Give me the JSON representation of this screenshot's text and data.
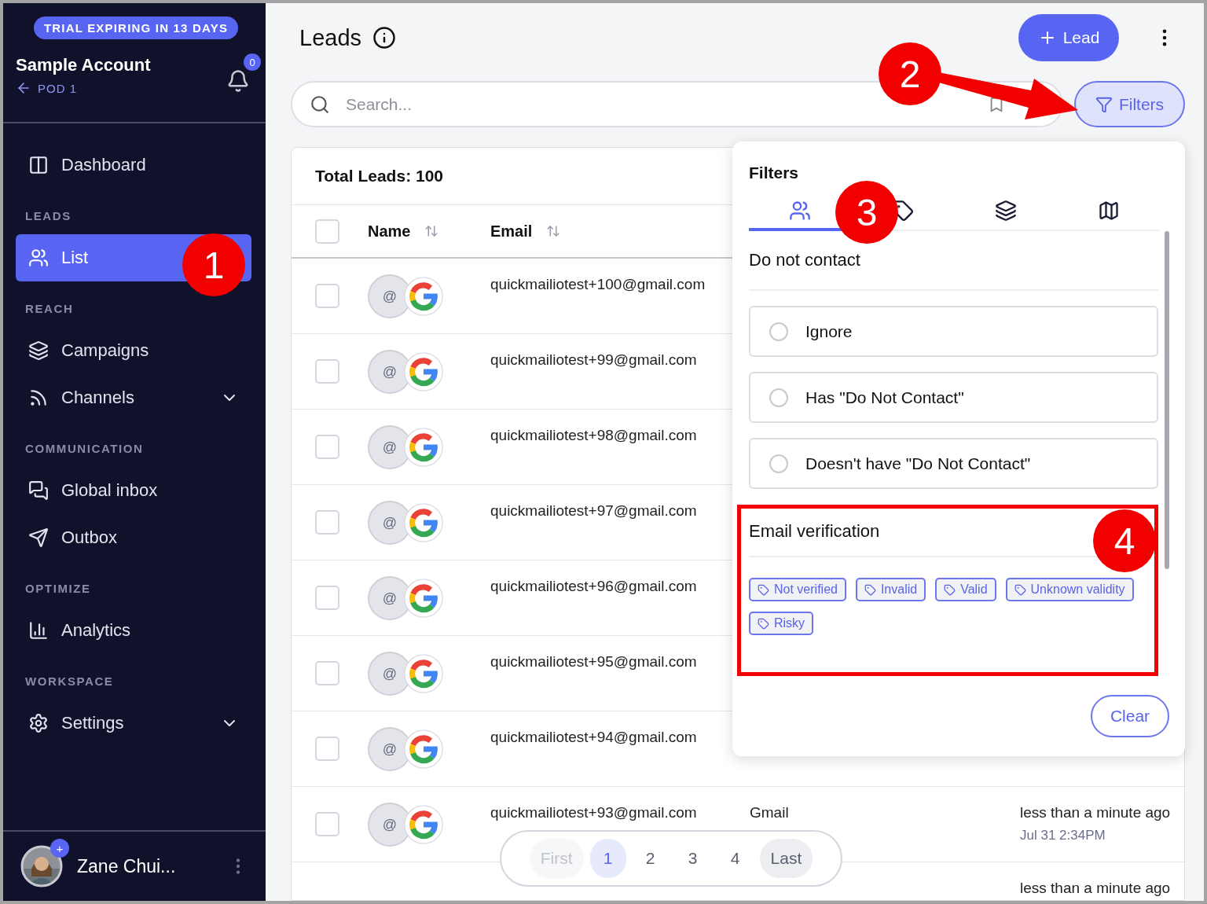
{
  "sidebar": {
    "trial_badge": "TRIAL EXPIRING IN 13 DAYS",
    "account": {
      "name": "Sample Account",
      "pod": "POD 1",
      "notifications": "0"
    },
    "sections": [
      {
        "items": [
          {
            "label": "Dashboard",
            "selected": false,
            "expandable": false
          }
        ]
      },
      {
        "heading": "LEADS",
        "items": [
          {
            "label": "List",
            "selected": true,
            "expandable": false
          }
        ]
      },
      {
        "heading": "REACH",
        "items": [
          {
            "label": "Campaigns",
            "selected": false,
            "expandable": false
          },
          {
            "label": "Channels",
            "selected": false,
            "expandable": true
          }
        ]
      },
      {
        "heading": "COMMUNICATION",
        "items": [
          {
            "label": "Global inbox",
            "selected": false,
            "expandable": false
          },
          {
            "label": "Outbox",
            "selected": false,
            "expandable": false
          }
        ]
      },
      {
        "heading": "OPTIMIZE",
        "items": [
          {
            "label": "Analytics",
            "selected": false,
            "expandable": false
          }
        ]
      },
      {
        "heading": "WORKSPACE",
        "items": [
          {
            "label": "Settings",
            "selected": false,
            "expandable": true
          }
        ]
      }
    ],
    "user": {
      "name": "Zane Chui...",
      "badge": "+"
    }
  },
  "header": {
    "title": "Leads",
    "add_button": "Lead"
  },
  "search": {
    "placeholder": "Search..."
  },
  "filters_button": "Filters",
  "table": {
    "total": "Total Leads: 100",
    "select_all_checked": false,
    "columns": [
      "Name",
      "Email"
    ],
    "rows": [
      {
        "checked": false,
        "avatar": "@",
        "email": "quickmailiotest+100@gmail.com"
      },
      {
        "checked": false,
        "avatar": "@",
        "email": "quickmailiotest+99@gmail.com"
      },
      {
        "checked": false,
        "avatar": "@",
        "email": "quickmailiotest+98@gmail.com"
      },
      {
        "checked": false,
        "avatar": "@",
        "email": "quickmailiotest+97@gmail.com"
      },
      {
        "checked": false,
        "avatar": "@",
        "email": "quickmailiotest+96@gmail.com"
      },
      {
        "checked": false,
        "avatar": "@",
        "email": "quickmailiotest+95@gmail.com"
      },
      {
        "checked": false,
        "avatar": "@",
        "email": "quickmailiotest+94@gmail.com"
      },
      {
        "checked": false,
        "avatar": "@",
        "email": "quickmailiotest+93@gmail.com",
        "provider": "Gmail",
        "time": "less than a minute ago",
        "date": "Jul 31 2:34PM"
      },
      {
        "time": "less than a minute ago"
      }
    ]
  },
  "pagination": [
    {
      "label": "First",
      "selected": false,
      "disabled": true,
      "hovered": false
    },
    {
      "label": "1",
      "selected": true,
      "disabled": false,
      "hovered": false
    },
    {
      "label": "2",
      "selected": false,
      "disabled": false,
      "hovered": false
    },
    {
      "label": "3",
      "selected": false,
      "disabled": false,
      "hovered": false
    },
    {
      "label": "4",
      "selected": false,
      "disabled": false,
      "hovered": false
    },
    {
      "label": "Last",
      "selected": false,
      "disabled": false,
      "hovered": true
    }
  ],
  "filters_panel": {
    "title": "Filters",
    "tabs": [
      {
        "selected": true
      },
      {
        "selected": false
      },
      {
        "selected": false
      },
      {
        "selected": false
      }
    ],
    "do_not_contact": {
      "heading": "Do not contact",
      "options": [
        {
          "label": "Ignore",
          "selected": false
        },
        {
          "label": "Has \"Do Not Contact\"",
          "selected": false
        },
        {
          "label": "Doesn't have \"Do Not Contact\"",
          "selected": false
        }
      ]
    },
    "email_verification": {
      "heading": "Email verification",
      "highlighted": true,
      "tags": [
        "Not verified",
        "Invalid",
        "Valid",
        "Unknown validity",
        "Risky"
      ]
    },
    "clear_button": "Clear"
  },
  "callouts": [
    "1",
    "2",
    "3",
    "4"
  ]
}
